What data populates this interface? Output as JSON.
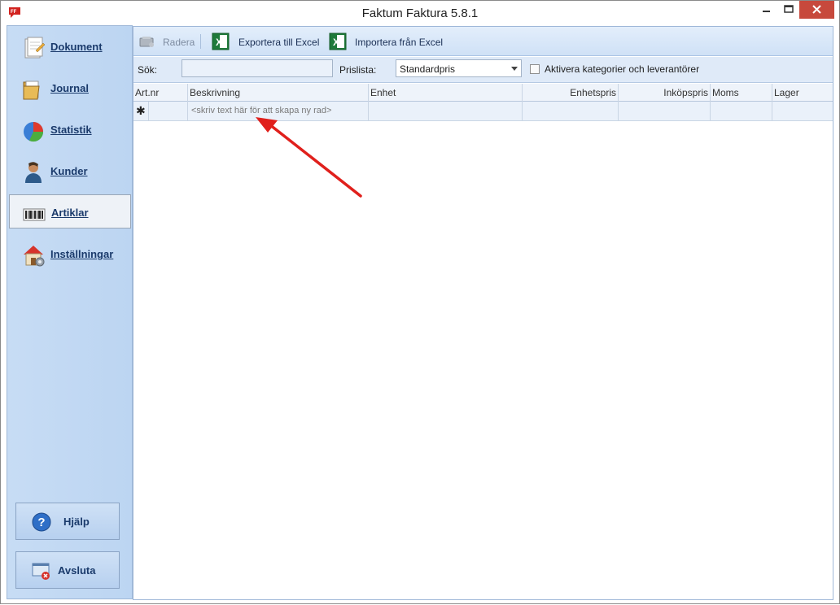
{
  "window": {
    "title": "Faktum Faktura 5.8.1",
    "app_icon_text": "FF"
  },
  "sidebar": {
    "items": [
      {
        "label": "Dokument",
        "icon": "document-icon"
      },
      {
        "label": "Journal",
        "icon": "folder-icon"
      },
      {
        "label": "Statistik",
        "icon": "pie-chart-icon"
      },
      {
        "label": "Kunder",
        "icon": "person-icon"
      },
      {
        "label": "Artiklar",
        "icon": "barcode-icon",
        "selected": true
      },
      {
        "label": "Inställningar",
        "icon": "house-settings-icon"
      }
    ],
    "help_label": "Hjälp",
    "exit_label": "Avsluta"
  },
  "toolbar": {
    "delete_label": "Radera",
    "export_label": "Exportera till Excel",
    "import_label": "Importera från Excel"
  },
  "filters": {
    "search_label": "Sök:",
    "search_value": "",
    "pricelist_label": "Prislista:",
    "pricelist_value": "Standardpris",
    "categories_label": "Aktivera kategorier och leverantörer",
    "categories_checked": false
  },
  "grid": {
    "columns": [
      "Art.nr",
      "Beskrivning",
      "Enhet",
      "Enhetspris",
      "Inköpspris",
      "Moms",
      "Lager"
    ],
    "new_row_marker": "✱",
    "new_row_hint": "<skriv text här för att skapa ny rad>"
  },
  "colors": {
    "accent": "#1a3a6b",
    "close_button": "#c7493c",
    "annotation_arrow": "#e0201c"
  }
}
